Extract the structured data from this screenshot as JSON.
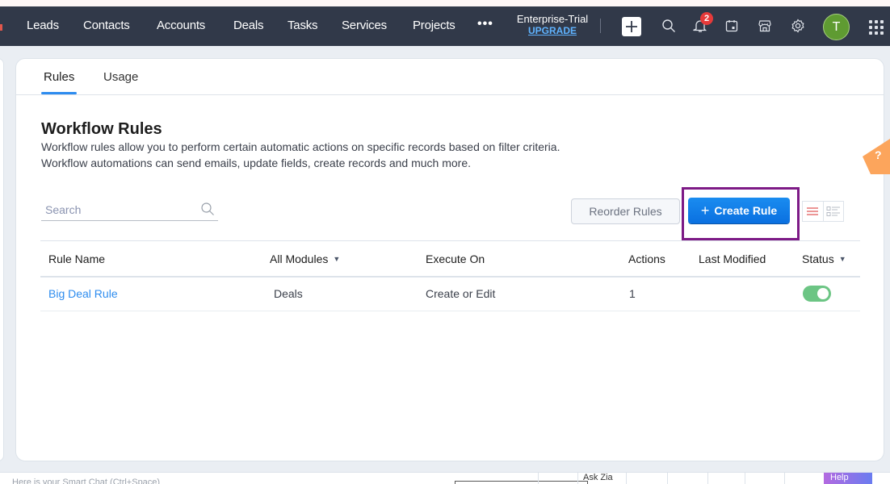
{
  "topbar": {
    "nav": [
      "Leads",
      "Contacts",
      "Accounts",
      "Deals",
      "Tasks",
      "Services",
      "Projects"
    ],
    "more_label": "•••",
    "edition": "Enterprise-Trial",
    "upgrade": "UPGRADE",
    "notification_count": "2",
    "avatar_initial": "T",
    "icons": [
      "plus-icon",
      "search-icon",
      "bell-icon",
      "calendar-icon",
      "marketplace-icon",
      "gear-icon",
      "apps-grid-icon"
    ]
  },
  "tabs": [
    {
      "label": "Rules",
      "active": true
    },
    {
      "label": "Usage",
      "active": false
    }
  ],
  "page": {
    "title": "Workflow Rules",
    "description": "Workflow rules allow you to perform certain automatic actions on specific records based on filter criteria. Workflow automations can send emails, update fields, create records and much more."
  },
  "search": {
    "placeholder": "Search",
    "value": ""
  },
  "toolbar": {
    "reorder_label": "Reorder Rules",
    "create_label": "Create Rule",
    "create_icon": "+"
  },
  "table": {
    "headers": {
      "rule_name": "Rule Name",
      "module": "All Modules",
      "execute_on": "Execute On",
      "actions": "Actions",
      "last_modified": "Last Modified",
      "status": "Status"
    },
    "rows": [
      {
        "rule_name": "Big Deal Rule",
        "module": "Deals",
        "execute_on": "Create or Edit",
        "actions": "1",
        "last_modified": "",
        "status": true
      }
    ]
  },
  "help_tab": "?",
  "bottom_bar": {
    "smart_chat_placeholder": "Here is your Smart Chat (Ctrl+Space)",
    "ask_zia": "Ask Zia",
    "help": "Help"
  },
  "colors": {
    "accent": "#2d8cef",
    "topbar": "#313949",
    "create_button": "#0a70e0",
    "highlight": "#7d1a86",
    "toggle_on": "#6cc584",
    "avatar": "#5f9b32",
    "help_tab": "#fca55c"
  }
}
